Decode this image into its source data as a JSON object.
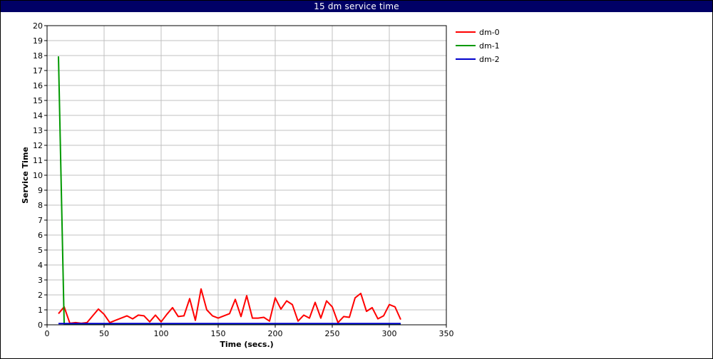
{
  "chart_data": {
    "type": "line",
    "title": "15 dm service time",
    "xlabel": "Time (secs.)",
    "ylabel": "Service Time",
    "xlim": [
      0,
      350
    ],
    "ylim": [
      0,
      20
    ],
    "xticks": [
      "0",
      "50",
      "100",
      "150",
      "200",
      "250",
      "300",
      "350"
    ],
    "yticks": [
      "0",
      "1",
      "2",
      "3",
      "4",
      "5",
      "6",
      "7",
      "8",
      "9",
      "10",
      "11",
      "12",
      "13",
      "14",
      "15",
      "16",
      "17",
      "18",
      "19",
      "20"
    ],
    "grid": true,
    "legend_position": "top-right",
    "series": [
      {
        "name": "dm-0",
        "color": "#ff0000",
        "x": [
          10,
          15,
          20,
          25,
          30,
          35,
          40,
          45,
          50,
          55,
          60,
          65,
          70,
          75,
          80,
          85,
          90,
          95,
          100,
          105,
          110,
          115,
          120,
          125,
          130,
          135,
          140,
          145,
          150,
          155,
          160,
          165,
          170,
          175,
          180,
          185,
          190,
          195,
          200,
          205,
          210,
          215,
          220,
          225,
          230,
          235,
          240,
          245,
          250,
          255,
          260,
          265,
          270,
          275,
          280,
          285,
          290,
          295,
          300,
          305,
          310
        ],
        "y": [
          0.75,
          1.2,
          0.1,
          0.15,
          0.1,
          0.15,
          0.6,
          1.05,
          0.7,
          0.15,
          0.3,
          0.45,
          0.6,
          0.4,
          0.65,
          0.6,
          0.2,
          0.65,
          0.2,
          0.7,
          1.15,
          0.55,
          0.6,
          1.75,
          0.3,
          2.4,
          1.0,
          0.6,
          0.45,
          0.6,
          0.75,
          1.7,
          0.55,
          1.95,
          0.45,
          0.45,
          0.5,
          0.25,
          1.8,
          1.05,
          1.6,
          1.35,
          0.25,
          0.65,
          0.45,
          1.5,
          0.45,
          1.6,
          1.2,
          0.15,
          0.55,
          0.5,
          1.8,
          2.1,
          0.9,
          1.15,
          0.4,
          0.6,
          1.35,
          1.2,
          0.35
        ]
      },
      {
        "name": "dm-1",
        "color": "#009900",
        "x": [
          10,
          15,
          20,
          25,
          30,
          35,
          40,
          45,
          50,
          55,
          60,
          65,
          70,
          75,
          80,
          85,
          90,
          95,
          100,
          105,
          110,
          115,
          120,
          125,
          130,
          135,
          140,
          145,
          150,
          155,
          160,
          165,
          170,
          175,
          180,
          185,
          190,
          195,
          200,
          205,
          210,
          215,
          220,
          225,
          230,
          235,
          240,
          245,
          250,
          255,
          260,
          265,
          270,
          275,
          280,
          285,
          290,
          295,
          300,
          305,
          310
        ],
        "y": [
          17.95,
          0.05,
          0.05,
          0.05,
          0.05,
          0.05,
          0.05,
          0.05,
          0.05,
          0.05,
          0.05,
          0.05,
          0.05,
          0.05,
          0.05,
          0.05,
          0.05,
          0.05,
          0.05,
          0.05,
          0.05,
          0.05,
          0.05,
          0.05,
          0.05,
          0.05,
          0.05,
          0.05,
          0.05,
          0.05,
          0.05,
          0.05,
          0.05,
          0.05,
          0.05,
          0.05,
          0.05,
          0.05,
          0.05,
          0.05,
          0.05,
          0.05,
          0.05,
          0.05,
          0.05,
          0.05,
          0.05,
          0.05,
          0.05,
          0.05,
          0.05,
          0.05,
          0.05,
          0.05,
          0.05,
          0.05,
          0.05,
          0.05,
          0.05,
          0.05,
          0.05
        ]
      },
      {
        "name": "dm-2",
        "color": "#0000cc",
        "x": [
          10,
          15,
          20,
          25,
          30,
          35,
          40,
          45,
          50,
          55,
          60,
          65,
          70,
          75,
          80,
          85,
          90,
          95,
          100,
          105,
          110,
          115,
          120,
          125,
          130,
          135,
          140,
          145,
          150,
          155,
          160,
          165,
          170,
          175,
          180,
          185,
          190,
          195,
          200,
          205,
          210,
          215,
          220,
          225,
          230,
          235,
          240,
          245,
          250,
          255,
          260,
          265,
          270,
          275,
          280,
          285,
          290,
          295,
          300,
          305,
          310
        ],
        "y": [
          0.08,
          0.08,
          0.08,
          0.08,
          0.08,
          0.08,
          0.08,
          0.08,
          0.08,
          0.08,
          0.08,
          0.08,
          0.08,
          0.08,
          0.08,
          0.08,
          0.08,
          0.08,
          0.08,
          0.08,
          0.08,
          0.08,
          0.08,
          0.08,
          0.08,
          0.08,
          0.08,
          0.08,
          0.08,
          0.08,
          0.08,
          0.08,
          0.08,
          0.08,
          0.08,
          0.08,
          0.08,
          0.08,
          0.08,
          0.08,
          0.08,
          0.08,
          0.08,
          0.08,
          0.08,
          0.08,
          0.08,
          0.08,
          0.08,
          0.08,
          0.08,
          0.08,
          0.08,
          0.08,
          0.08,
          0.08,
          0.08,
          0.08,
          0.08,
          0.08,
          0.08
        ]
      }
    ]
  }
}
